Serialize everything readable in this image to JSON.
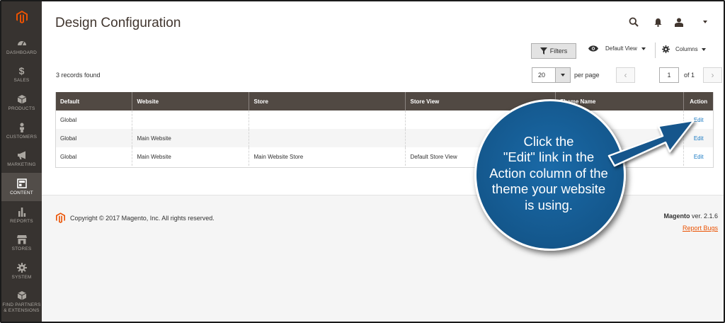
{
  "sidebar": {
    "items": [
      {
        "label": "DASHBOARD",
        "icon": "speedometer-icon"
      },
      {
        "label": "SALES",
        "icon": "dollar-icon"
      },
      {
        "label": "PRODUCTS",
        "icon": "cube-icon"
      },
      {
        "label": "CUSTOMERS",
        "icon": "person-icon"
      },
      {
        "label": "MARKETING",
        "icon": "megaphone-icon"
      },
      {
        "label": "CONTENT",
        "icon": "layout-icon",
        "active": true
      },
      {
        "label": "REPORTS",
        "icon": "bar-chart-icon"
      },
      {
        "label": "STORES",
        "icon": "storefront-icon"
      },
      {
        "label": "SYSTEM",
        "icon": "gear-icon"
      },
      {
        "label": "FIND PARTNERS & EXTENSIONS",
        "line1": "FIND PARTNERS",
        "line2": "& EXTENSIONS",
        "icon": "box-icon"
      }
    ]
  },
  "header": {
    "title": "Design Configuration"
  },
  "toolbar": {
    "filters_label": "Filters",
    "view_label": "Default View",
    "columns_label": "Columns"
  },
  "grid": {
    "records_found": "3 records found",
    "per_page_value": "20",
    "per_page_label": "per page",
    "page_value": "1",
    "page_of": "of 1",
    "columns": [
      "Default",
      "Website",
      "Store",
      "Store View",
      "Theme Name",
      "Action"
    ],
    "rows": [
      {
        "default": "Global",
        "website": "",
        "store": "",
        "store_view": "",
        "theme": "",
        "action": "Edit"
      },
      {
        "default": "Global",
        "website": "Main Website",
        "store": "",
        "store_view": "",
        "theme": "",
        "action": "Edit"
      },
      {
        "default": "Global",
        "website": "Main Website",
        "store": "Main Website Store",
        "store_view": "Default Store View",
        "theme": "",
        "action": "Edit"
      }
    ]
  },
  "footer": {
    "copyright": "Copyright © 2017 Magento, Inc. All rights reserved.",
    "brand": "Magento",
    "version": " ver. 2.1.6",
    "report_bugs": "Report Bugs"
  },
  "callout": {
    "line1": "Click the",
    "line2": "\"Edit\" link in the",
    "line3": "Action column of the",
    "line4": "theme your website",
    "line5": "is using."
  },
  "colors": {
    "sidebar_bg": "#373330",
    "header_row_bg": "#514943",
    "link": "#1979c3",
    "callout_blue": "#14578c",
    "report_bugs": "#eb5202"
  }
}
